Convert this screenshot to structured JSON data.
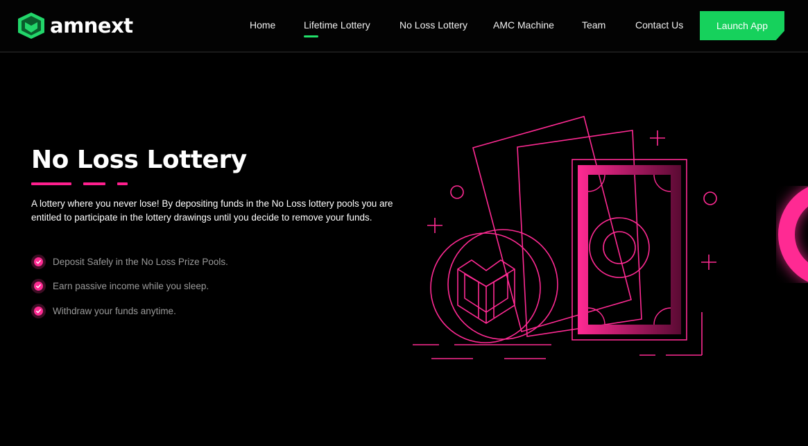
{
  "brand": {
    "name": "amnext",
    "logo_icon": "shield-heart-icon",
    "accent": "#16d15c"
  },
  "nav": {
    "items": [
      {
        "label": "Home",
        "active": false
      },
      {
        "label": "Lifetime Lottery",
        "active": true
      },
      {
        "label": "No Loss Lottery",
        "active": false
      },
      {
        "label": "AMC Machine",
        "active": false
      },
      {
        "label": "Team",
        "active": false
      },
      {
        "label": "Contact Us",
        "active": false
      }
    ],
    "cta_label": "Launch App"
  },
  "hero": {
    "title": "No Loss Lottery",
    "description": "A lottery where you never lose! By depositing funds in the No Loss lottery pools you are entitled to participate in the lottery drawings until you decide to remove your funds.",
    "features": [
      "Deposit Safely in the No Loss Prize Pools.",
      "Earn passive income while you sleep.",
      "Withdraw your funds anytime."
    ],
    "accent": "#ff1f8e",
    "illustration_icon": "coin-and-banknote-icon"
  }
}
